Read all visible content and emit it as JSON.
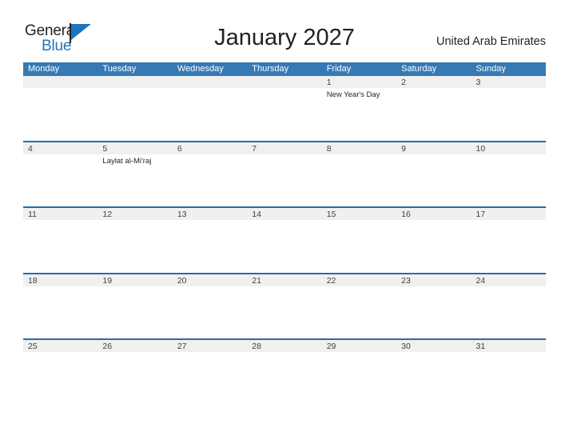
{
  "brand": {
    "name_part1": "General",
    "name_part2": "Blue",
    "flag_icon": "triangle-flag-icon"
  },
  "header": {
    "title": "January 2027",
    "region": "United Arab Emirates"
  },
  "colors": {
    "header_blue": "#3679b5",
    "row_line_blue": "#2a6ca5",
    "date_strip_gray": "#f0f0f0",
    "brand_blue": "#1d76bc",
    "text_dark": "#231f20"
  },
  "weekdays": [
    "Monday",
    "Tuesday",
    "Wednesday",
    "Thursday",
    "Friday",
    "Saturday",
    "Sunday"
  ],
  "weeks": [
    {
      "days": [
        {
          "num": "",
          "event": ""
        },
        {
          "num": "",
          "event": ""
        },
        {
          "num": "",
          "event": ""
        },
        {
          "num": "",
          "event": ""
        },
        {
          "num": "1",
          "event": "New Year's Day"
        },
        {
          "num": "2",
          "event": ""
        },
        {
          "num": "3",
          "event": ""
        }
      ]
    },
    {
      "days": [
        {
          "num": "4",
          "event": ""
        },
        {
          "num": "5",
          "event": "Laylat al-Mi'raj"
        },
        {
          "num": "6",
          "event": ""
        },
        {
          "num": "7",
          "event": ""
        },
        {
          "num": "8",
          "event": ""
        },
        {
          "num": "9",
          "event": ""
        },
        {
          "num": "10",
          "event": ""
        }
      ]
    },
    {
      "days": [
        {
          "num": "11",
          "event": ""
        },
        {
          "num": "12",
          "event": ""
        },
        {
          "num": "13",
          "event": ""
        },
        {
          "num": "14",
          "event": ""
        },
        {
          "num": "15",
          "event": ""
        },
        {
          "num": "16",
          "event": ""
        },
        {
          "num": "17",
          "event": ""
        }
      ]
    },
    {
      "days": [
        {
          "num": "18",
          "event": ""
        },
        {
          "num": "19",
          "event": ""
        },
        {
          "num": "20",
          "event": ""
        },
        {
          "num": "21",
          "event": ""
        },
        {
          "num": "22",
          "event": ""
        },
        {
          "num": "23",
          "event": ""
        },
        {
          "num": "24",
          "event": ""
        }
      ]
    },
    {
      "days": [
        {
          "num": "25",
          "event": ""
        },
        {
          "num": "26",
          "event": ""
        },
        {
          "num": "27",
          "event": ""
        },
        {
          "num": "28",
          "event": ""
        },
        {
          "num": "29",
          "event": ""
        },
        {
          "num": "30",
          "event": ""
        },
        {
          "num": "31",
          "event": ""
        }
      ]
    }
  ]
}
